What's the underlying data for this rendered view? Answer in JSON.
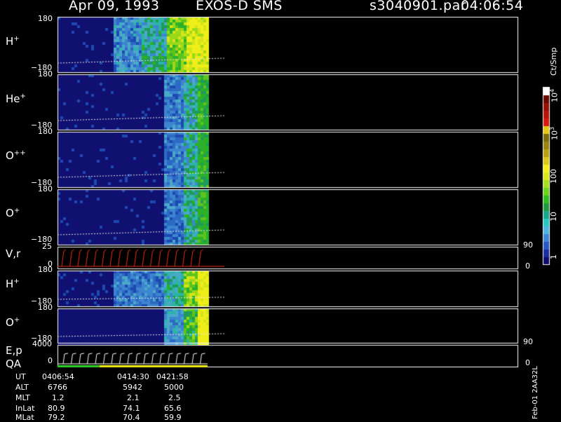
{
  "header": {
    "date": "Apr 09, 1993",
    "instrument": "EXOS-D SMS",
    "file": "s3040901.par",
    "time": "04:06:54"
  },
  "panels": [
    {
      "id": "h1",
      "label": "H",
      "sup": "+",
      "ytop": "180",
      "ybot": "−180"
    },
    {
      "id": "he",
      "label": "He",
      "sup": "+",
      "ytop": "180",
      "ybot": "−180"
    },
    {
      "id": "opp",
      "label": "O",
      "sup": "++",
      "ytop": "180",
      "ybot": "−180"
    },
    {
      "id": "o1",
      "label": "O",
      "sup": "+",
      "ytop": "180",
      "ybot": "−180"
    },
    {
      "id": "vr",
      "label": "V,r",
      "sup": "",
      "ytop": "25",
      "ybot": "0",
      "rtop": "90",
      "rbot": "0"
    },
    {
      "id": "h2",
      "label": "H",
      "sup": "+",
      "ytop": "180",
      "ybot": "−180"
    },
    {
      "id": "o2",
      "label": "O",
      "sup": "+",
      "ytop": "180",
      "ybot": "−180"
    },
    {
      "id": "ep",
      "label": "E,p",
      "sup": "",
      "ytop": "4000",
      "ybot": "0",
      "rtop": "90",
      "rbot": "0"
    },
    {
      "id": "qa",
      "label": "QA",
      "sup": ""
    }
  ],
  "colorbar": {
    "unit": "Ct/Smp",
    "labels": [
      "1",
      "10",
      "100",
      "10",
      "10"
    ],
    "exponents": [
      "",
      "",
      "",
      "3",
      "4"
    ],
    "colors": [
      "#0d0d6b",
      "#1c2fa0",
      "#2a58c8",
      "#3e86d8",
      "#4ab5e0",
      "#27c8c0",
      "#1aa88c",
      "#1f9a3c",
      "#2fbf1f",
      "#6cd41a",
      "#a6e01a",
      "#d8e81a",
      "#f2ef18",
      "#d9c815",
      "#b9a011",
      "#9a830e",
      "#7a6e0b",
      "#e8c812",
      "#d81a0f",
      "#b81408",
      "#971005",
      "#6a0a02",
      "#ffffff"
    ]
  },
  "footer": {
    "rows": [
      {
        "label": "UT",
        "values": [
          "0406:54",
          "0414:30",
          "0421:58"
        ]
      },
      {
        "label": "ALT",
        "values": [
          "6766",
          "5942",
          "5000"
        ]
      },
      {
        "label": "MLT",
        "values": [
          "1.2",
          "2.1",
          "2.5"
        ]
      },
      {
        "label": "InLat",
        "values": [
          "80.9",
          "74.1",
          "65.6"
        ]
      },
      {
        "label": "MLat",
        "values": [
          "79.2",
          "70.4",
          "59.9"
        ]
      }
    ],
    "version": "Feb-01 2AA32L"
  },
  "chart_data": {
    "type": "heatmap",
    "x_ticks_ut": [
      "0406:54",
      "0414:30",
      "0421:58"
    ],
    "y_range_pitch_deg": [
      -180,
      180
    ],
    "color_scale": "log",
    "color_range_ct_per_smp": [
      1,
      10000
    ],
    "data_time_fraction_end": 0.33
  }
}
